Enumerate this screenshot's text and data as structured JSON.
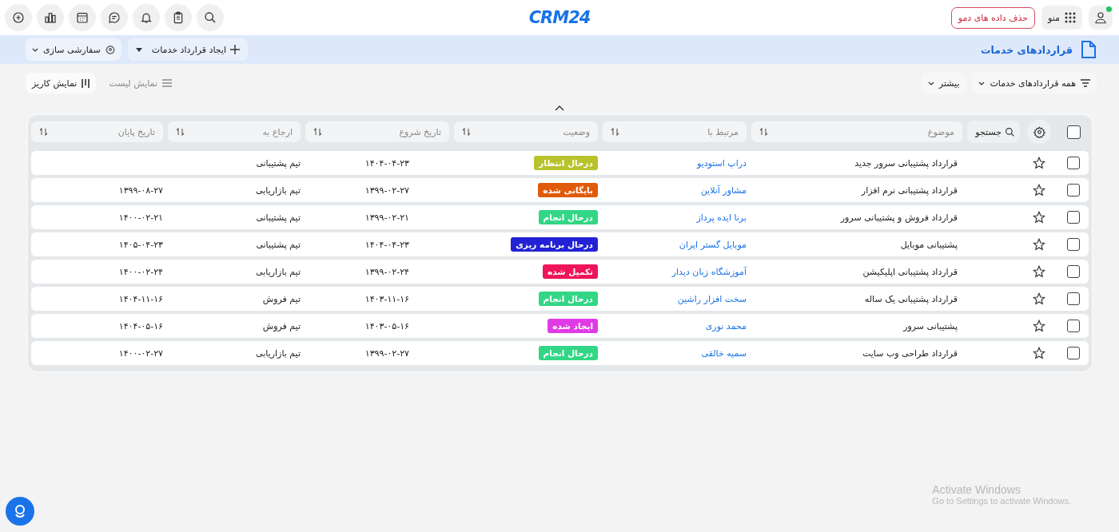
{
  "topbar": {
    "logo": "CRM24",
    "menu_label": "منو",
    "demo_button": "حذف داده های دمو",
    "user_online": true
  },
  "header": {
    "title": "قراردادهای خدمات",
    "create_button": "ایجاد قرارداد خدمات",
    "customize_button": "سفارشی سازی"
  },
  "toolbar": {
    "filter": "همه قراردادهای خدمات",
    "more": "بیشتر",
    "views": [
      {
        "label": "نمایش لیست",
        "kind": "list",
        "selected": false
      },
      {
        "label": "نمایش کاریز",
        "kind": "kanban",
        "selected": true
      }
    ]
  },
  "table": {
    "search_button": "جستجو",
    "all_checked": false,
    "columns": [
      "موضوع",
      "مرتبط با",
      "وضعیت",
      "تاریخ شروع",
      "ارجاع به",
      "تاریخ پایان"
    ],
    "rows": [
      {
        "checked": false,
        "starred": false,
        "subject": "قرارداد پشتیبانی سرور جدید",
        "related": "دراپ استودیو",
        "status": "درحال انتظار",
        "color": "#b8c22a",
        "start": "۱۴۰۴-۰۴-۲۳",
        "assigned": "تیم پشتیبانی"
      },
      {
        "checked": false,
        "starred": false,
        "subject": "قرارداد پشتیبانی نرم افزار",
        "related": "مشاور آنلاین",
        "status": "بایگانی شده",
        "color": "#e05a0c",
        "start": "۱۳۹۹-۰۲-۲۷",
        "assigned": "تیم بازاریابی",
        "end": "۱۳۹۹-۰۸-۲۷"
      },
      {
        "checked": false,
        "starred": false,
        "subject": "قرارداد فروش و پشتیبانی سرور",
        "related": "برنا ایده پرداز",
        "status": "درحال انجام",
        "color": "#33d685",
        "start": "۱۳۹۹-۰۲-۲۱",
        "assigned": "تیم پشتیبانی",
        "end": "۱۴۰۰-۰۲-۲۱"
      },
      {
        "checked": false,
        "starred": false,
        "subject": "پشتیبانی موبایل",
        "related": "موبایل گستر ایران",
        "status": "درحال برنامه ریزی",
        "color": "#2222d4",
        "start": "۱۴۰۴-۰۴-۲۳",
        "assigned": "تیم پشتیبانی",
        "end": "۱۴۰۵-۰۴-۲۳"
      },
      {
        "checked": false,
        "starred": false,
        "subject": "قرارداد پشتیبانی اپلیکیشن",
        "related": "آموزشگاه زبان دیدار",
        "status": "تکمیل شده",
        "color": "#f0145a",
        "start": "۱۳۹۹-۰۲-۲۴",
        "assigned": "تیم بازاریابی",
        "end": "۱۴۰۰-۰۲-۲۴"
      },
      {
        "checked": false,
        "starred": false,
        "subject": "قرارداد پشتیبانی یک ساله",
        "related": "سخت افزار راشین",
        "status": "درحال انجام",
        "color": "#33d685",
        "start": "۱۴۰۳-۱۱-۱۶",
        "assigned": "تیم فروش",
        "end": "۱۴۰۴-۱۱-۱۶"
      },
      {
        "checked": false,
        "starred": false,
        "subject": "پشتیبانی سرور",
        "related": "محمد نوری",
        "status": "ایجاد شده",
        "color": "#e03ae6",
        "start": "۱۴۰۳-۰۵-۱۶",
        "assigned": "تیم فروش",
        "end": "۱۴۰۴-۰۵-۱۶"
      },
      {
        "checked": false,
        "starred": false,
        "subject": "قرارداد طراحی وب سایت",
        "related": "سمیه خالقی",
        "status": "درحال انجام",
        "color": "#33d685",
        "start": "۱۳۹۹-۰۲-۲۷",
        "assigned": "تیم بازاریابی",
        "end": "۱۴۰۰-۰۲-۲۷"
      }
    ]
  },
  "os_notice": {
    "title": "Activate Windows",
    "text": "Go to Settings to activate Windows."
  }
}
